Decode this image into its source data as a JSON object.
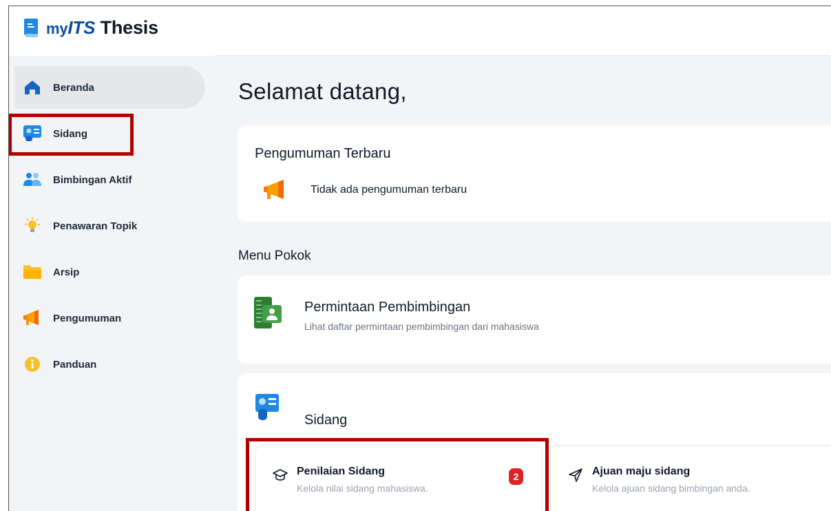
{
  "app": {
    "logo_my": "my",
    "logo_its": "ITS",
    "logo_suffix": " Thesis"
  },
  "sidebar": {
    "items": [
      {
        "label": "Beranda",
        "icon": "home-icon",
        "active": true
      },
      {
        "label": "Sidang",
        "icon": "id-card-icon",
        "active": false
      },
      {
        "label": "Bimbingan Aktif",
        "icon": "users-icon",
        "active": false
      },
      {
        "label": "Penawaran Topik",
        "icon": "lightbulb-icon",
        "active": false
      },
      {
        "label": "Arsip",
        "icon": "folder-icon",
        "active": false
      },
      {
        "label": "Pengumuman",
        "icon": "megaphone-icon",
        "active": false
      },
      {
        "label": "Panduan",
        "icon": "info-icon",
        "active": false
      }
    ]
  },
  "main": {
    "welcome": "Selamat datang,",
    "announcement": {
      "title": "Pengumuman Terbaru",
      "empty_text": "Tidak ada pengumuman terbaru"
    },
    "menu_title": "Menu Pokok",
    "permintaan": {
      "title": "Permintaan Pembimbingan",
      "subtitle": "Lihat daftar permintaan pembimbingan dari mahasiswa"
    },
    "sidang": {
      "title": "Sidang",
      "penilaian": {
        "title": "Penilaian Sidang",
        "desc": "Kelola nilai sidang mahasiswa.",
        "badge": "2"
      },
      "ajuan": {
        "title": "Ajuan maju sidang",
        "desc": "Kelola ajuan sidang bimbingan anda."
      }
    }
  },
  "colors": {
    "brand_blue": "#0b4da2",
    "highlight_red": "#b00000",
    "badge_red": "#dc2626",
    "sidebar_bg": "#f3f4f6"
  }
}
